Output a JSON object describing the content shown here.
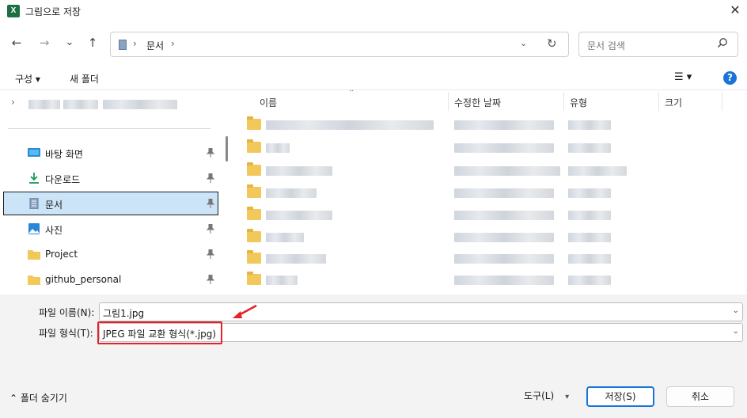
{
  "window": {
    "title": "그림으로 저장",
    "app_icon_letter": "X",
    "close": "✕"
  },
  "nav": {
    "back": "←",
    "forward": "→",
    "recent": "⌄",
    "up": "↑",
    "breadcrumb": "문서",
    "sep": "›",
    "dropdown": "⌄",
    "refresh": "↻"
  },
  "search": {
    "placeholder": "문서 검색"
  },
  "toolbar": {
    "organize": "구성 ▾",
    "new_folder": "새 폴더",
    "view": "☰ ▾",
    "help": "?"
  },
  "sidebar": {
    "items": [
      {
        "label": "바탕 화면",
        "icon": "desktop-icon"
      },
      {
        "label": "다운로드",
        "icon": "download-icon"
      },
      {
        "label": "문서",
        "icon": "documents-icon",
        "selected": true
      },
      {
        "label": "사진",
        "icon": "pictures-icon"
      },
      {
        "label": "Project",
        "icon": "folder-icon"
      },
      {
        "label": "github_personal",
        "icon": "folder-icon"
      }
    ]
  },
  "filelist": {
    "columns": [
      "이름",
      "수정한 날짜",
      "유형",
      "크기"
    ],
    "sort_indicator": "⌃"
  },
  "form": {
    "filename_label": "파일 이름(N):",
    "filename_value": "그림1.jpg",
    "filetype_label": "파일 형식(T):",
    "filetype_value": "JPEG 파일 교환 형식(*.jpg)",
    "combo_arrow": "⌄"
  },
  "footer": {
    "hide_folders": "⌃  폴더 숨기기",
    "tools": "도구(L)",
    "tools_caret": "▾",
    "save": "저장(S)",
    "cancel": "취소"
  },
  "colors": {
    "selection_bg": "#cce4f7",
    "accent": "#1a73d9",
    "highlight_red": "#e3222a",
    "folder": "#f3c85a"
  }
}
